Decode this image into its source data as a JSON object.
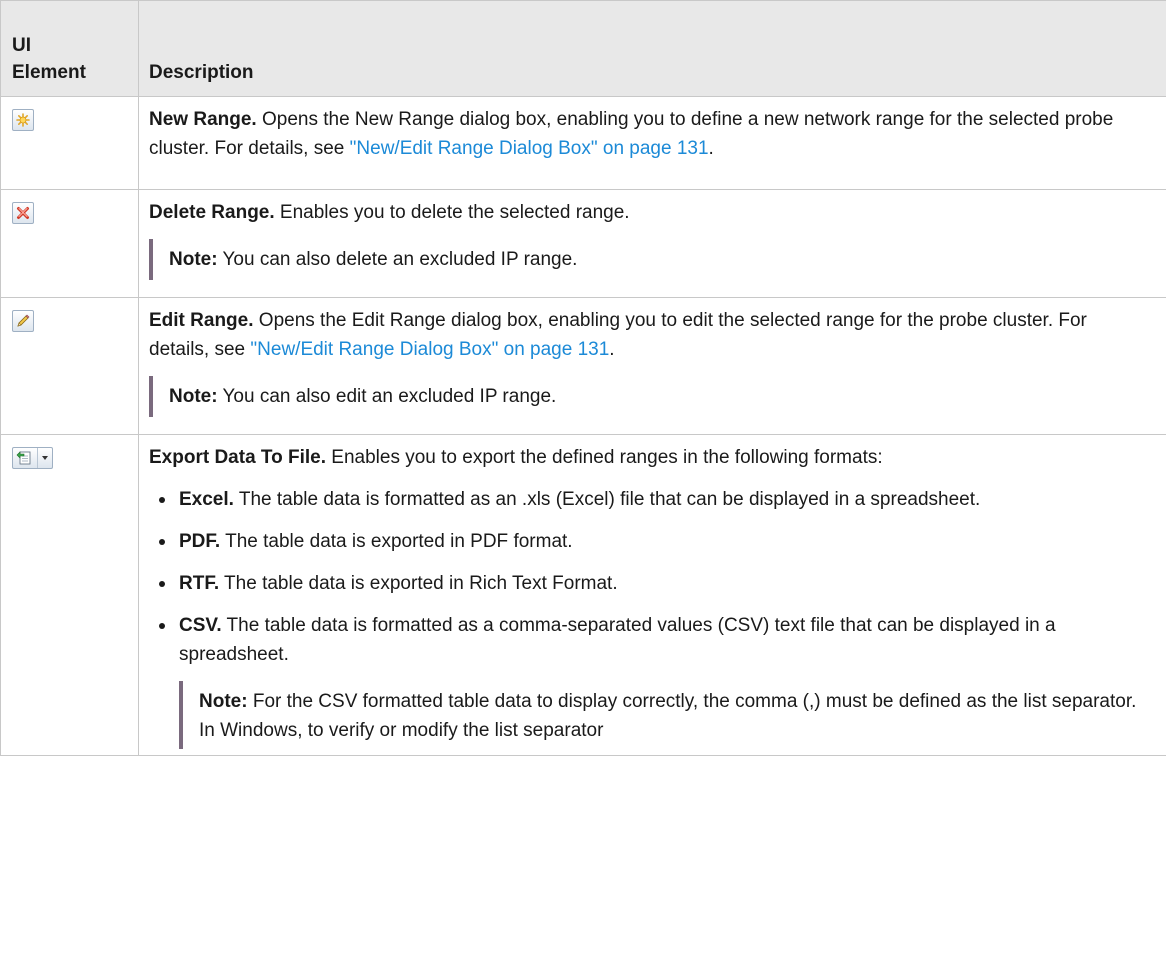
{
  "header": {
    "col1_line1": "UI",
    "col1_line2": "Element",
    "col2": "Description"
  },
  "rows": [
    {
      "icon": "new-range-icon",
      "title": "New Range.",
      "text": " Opens the New Range dialog box, enabling you to define a new network range for the selected probe cluster. For details, see ",
      "link": "\"New/Edit Range Dialog Box\" on page 131",
      "after": "."
    },
    {
      "icon": "delete-icon",
      "title": "Delete Range.",
      "text": " Enables you to delete the selected range.",
      "note_label": "Note:",
      "note_text": "  You can also delete an excluded IP range."
    },
    {
      "icon": "edit-icon",
      "title": "Edit Range.",
      "text": " Opens the Edit Range dialog box, enabling you to edit the selected range for the probe cluster. For details, see ",
      "link": "\"New/Edit Range Dialog Box\" on page 131",
      "after": ".",
      "note_label": "Note:",
      "note_text": "  You can also edit an excluded IP range."
    },
    {
      "icon": "export-icon",
      "title": "Export Data To File.",
      "text": " Enables you to export the defined ranges in the following formats:",
      "items": [
        {
          "label": "Excel.",
          "text": " The table data is formatted as an .xls (Excel) file that can be displayed in a spreadsheet."
        },
        {
          "label": "PDF.",
          "text": " The table data is exported in PDF format."
        },
        {
          "label": "RTF.",
          "text": " The table data is exported in Rich Text Format."
        },
        {
          "label": "CSV.",
          "text": " The table data is formatted as a comma-separated values (CSV) text file that can be displayed in a spreadsheet."
        }
      ],
      "note_label": "Note:",
      "note_text": " For the CSV formatted table data to display correctly, the comma (,) must be defined as the list separator. In Windows, to verify or modify the list separator"
    }
  ],
  "colors": {
    "link": "#1c8ad7",
    "header_bg": "#e8e8e8",
    "note_bar": "#7a6a7e",
    "border": "#c8c8c8"
  }
}
